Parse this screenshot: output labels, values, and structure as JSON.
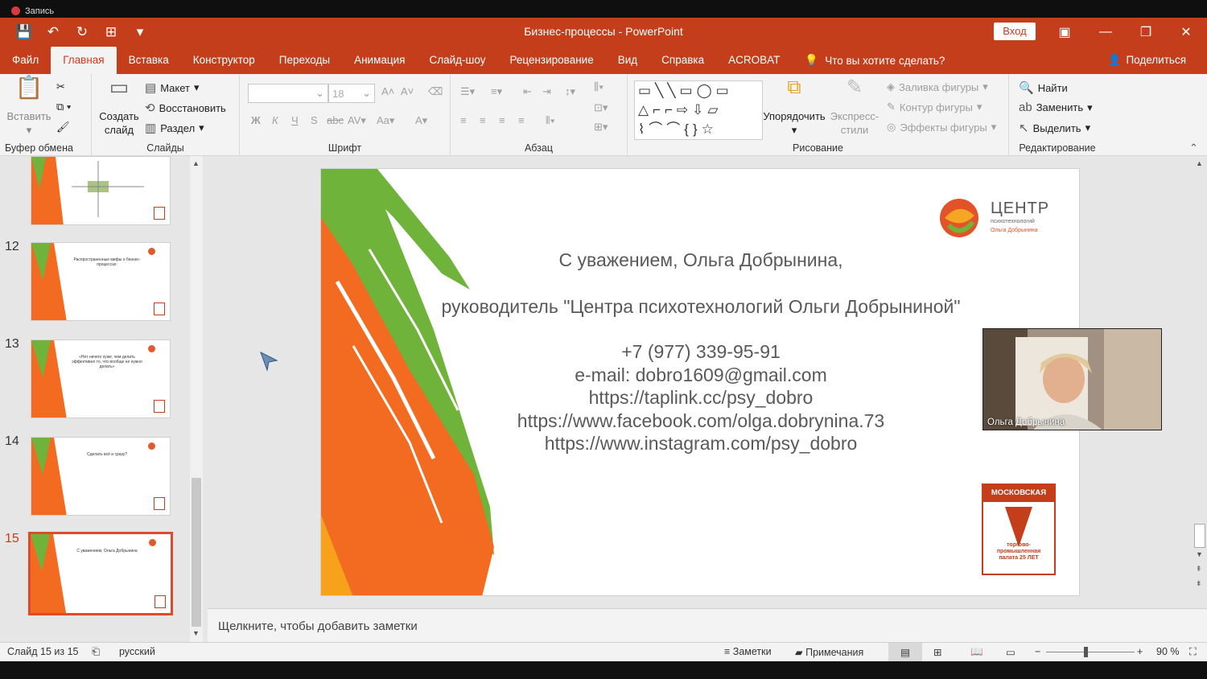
{
  "recorder": {
    "label": "Запись"
  },
  "window": {
    "title": "Бизнес-процессы  -  PowerPoint",
    "login": "Вход"
  },
  "tabs": [
    "Файл",
    "Главная",
    "Вставка",
    "Конструктор",
    "Переходы",
    "Анимация",
    "Слайд-шоу",
    "Рецензирование",
    "Вид",
    "Справка",
    "ACROBAT"
  ],
  "tell_me": "Что вы хотите сделать?",
  "share": "Поделиться",
  "ribbon": {
    "clipboard": {
      "label": "Буфер обмена",
      "paste": "Вставить"
    },
    "slides": {
      "label": "Слайды",
      "new_slide_1": "Создать",
      "new_slide_2": "слайд",
      "layout": "Макет",
      "reset": "Восстановить",
      "section": "Раздел"
    },
    "font": {
      "label": "Шрифт",
      "size": "18"
    },
    "paragraph": {
      "label": "Абзац"
    },
    "drawing": {
      "label": "Рисование",
      "arrange": "Упорядочить",
      "quick_styles_1": "Экспресс-",
      "quick_styles_2": "стили",
      "fill": "Заливка фигуры",
      "outline": "Контур фигуры",
      "effects": "Эффекты фигуры"
    },
    "editing": {
      "label": "Редактирование",
      "find": "Найти",
      "replace": "Заменить",
      "select": "Выделить"
    }
  },
  "thumbnails": [
    {
      "number": "",
      "text": ""
    },
    {
      "number": "12",
      "text": "Распространенные мифы о бизнес-процессах:"
    },
    {
      "number": "13",
      "text": "«Нет ничего хуже, чем делать эффективно то, что вообще не нужно делать»"
    },
    {
      "number": "14",
      "text": "Сделать всё и сразу?"
    },
    {
      "number": "15",
      "text": "С уважением, Ольга Добрынина"
    }
  ],
  "slide": {
    "logo_main": "ЦЕНТР",
    "logo_sub": "психотехнологий",
    "logo_name": "Ольга Добрынина",
    "greeting": "С уважением, Ольга Добрынина,",
    "role": "руководитель \"Центра психотехнологий Ольги Добрыниной\"",
    "phone": "+7 (977) 339-95-91",
    "email": "e-mail: dobro1609@gmail.com",
    "link1": "https://taplink.cc/psy_dobro",
    "link2": "https://www.facebook.com/olga.dobrynina.73",
    "link3": "https://www.instagram.com/psy_dobro",
    "badge_top": "МОСКОВСКАЯ",
    "badge_bottom": "торгово-промышленная палата 25 ЛЕТ"
  },
  "camera": {
    "name": "Ольга Добрынина"
  },
  "notes_placeholder": "Щелкните, чтобы добавить заметки",
  "status": {
    "slide_info": "Слайд 15 из 15",
    "language": "русский",
    "notes": "Заметки",
    "comments": "Примечания",
    "zoom": "90 %"
  },
  "colors": {
    "accent": "#c43e1c",
    "green": "#6fb33a",
    "orange": "#f26b21"
  }
}
